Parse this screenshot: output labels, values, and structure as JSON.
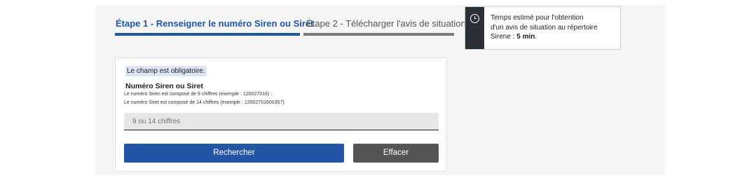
{
  "steps": {
    "step1_label": "Étape 1 - Renseigner le numéro Siren ou Siret",
    "step2_label": "Étape 2 - Télécharger l'avis de situation"
  },
  "info": {
    "icon": "clock-icon",
    "text_line1": "Temps estimé pour l'obtention",
    "text_line2": "d'un avis de situation au répertoire",
    "text_prefix": "Sirene : ",
    "text_bold": "5 min",
    "text_suffix": "."
  },
  "form": {
    "required_note": "Le champ est obligatoire.",
    "field_label": "Numéro Siren ou Siret",
    "help_line1": "Le numéro Siren est composé de 9 chiffres (exemple : 120027016) ;",
    "help_line2": "Le numéro Siret est composé de 14 chiffres (exemple : 12002701600357)",
    "input_placeholder": "9 ou 14 chiffres",
    "input_value": "",
    "search_button": "Rechercher",
    "clear_button": "Effacer"
  },
  "colors": {
    "accent": "#2355a6",
    "inactive_step": "#7a7a7a",
    "info_strip": "#2b2f36",
    "required_bg": "#dce6f7",
    "clear_button": "#555555"
  }
}
